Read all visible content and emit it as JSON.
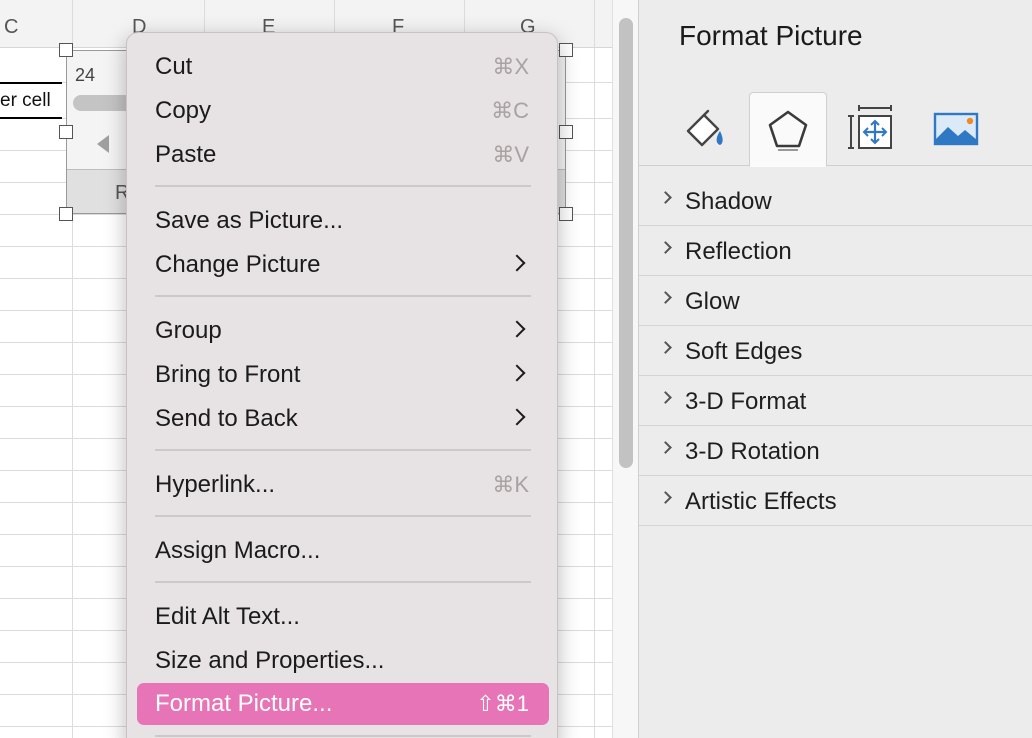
{
  "sheet": {
    "columns": [
      "C",
      "D",
      "E",
      "F",
      "G"
    ],
    "cell_text": "er cell",
    "picture": {
      "number": "24",
      "button_label": "R"
    }
  },
  "context_menu": {
    "items": [
      {
        "label": "Cut",
        "shortcut": "⌘X"
      },
      {
        "label": "Copy",
        "shortcut": "⌘C"
      },
      {
        "label": "Paste",
        "shortcut": "⌘V"
      },
      {
        "label": "Save as Picture..."
      },
      {
        "label": "Change Picture",
        "submenu": true
      },
      {
        "label": "Group",
        "submenu": true
      },
      {
        "label": "Bring to Front",
        "submenu": true
      },
      {
        "label": "Send to Back",
        "submenu": true
      },
      {
        "label": "Hyperlink...",
        "shortcut": "⌘K"
      },
      {
        "label": "Assign Macro..."
      },
      {
        "label": "Edit Alt Text..."
      },
      {
        "label": "Size and Properties..."
      },
      {
        "label": "Format Picture...",
        "shortcut": "⇧⌘1",
        "highlighted": true
      }
    ],
    "highlight_color": "#e674b6"
  },
  "format_pane": {
    "title": "Format Picture",
    "tabs": [
      {
        "icon": "fill-line-icon"
      },
      {
        "icon": "effects-pentagon-icon",
        "active": true
      },
      {
        "icon": "size-properties-icon"
      },
      {
        "icon": "picture-icon"
      }
    ],
    "sections": [
      "Shadow",
      "Reflection",
      "Glow",
      "Soft Edges",
      "3-D Format",
      "3-D Rotation",
      "Artistic Effects"
    ]
  }
}
